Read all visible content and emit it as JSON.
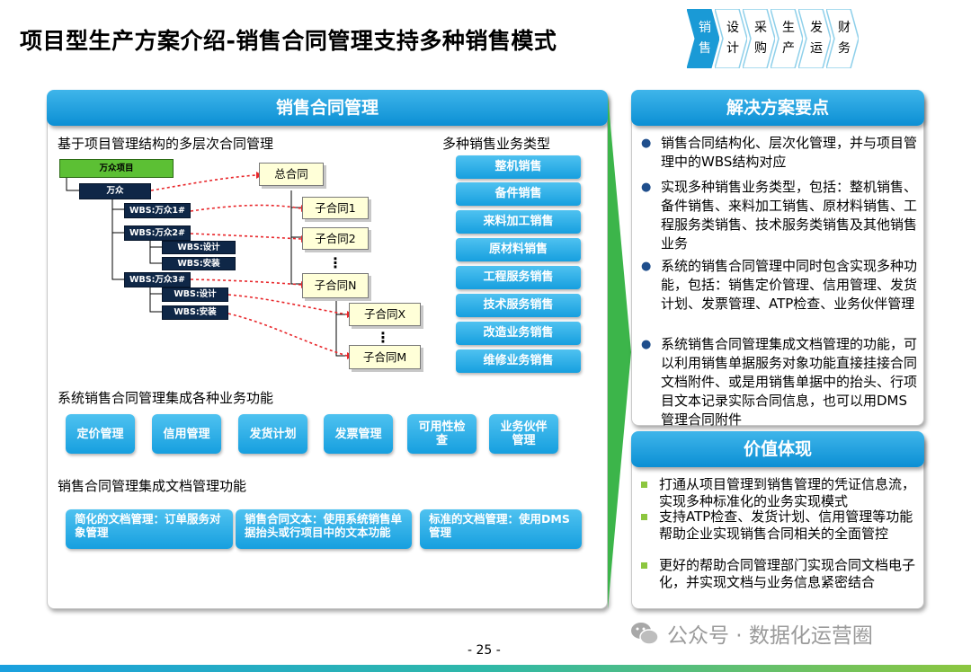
{
  "title": "项目型生产方案介绍-销售合同管理支持多种销售模式",
  "process_steps": [
    {
      "t1": "销",
      "t2": "售"
    },
    {
      "t1": "设",
      "t2": "计"
    },
    {
      "t1": "采",
      "t2": "购"
    },
    {
      "t1": "生",
      "t2": "产"
    },
    {
      "t1": "发",
      "t2": "运"
    },
    {
      "t1": "财",
      "t2": "务"
    }
  ],
  "left_panel": {
    "header": "销售合同管理",
    "structure_title": "基于项目管理结构的多层次合同管理",
    "types_title": "多种销售业务类型",
    "wbs": {
      "root": "万众项目",
      "wanzhong": "万众",
      "w1": "WBS:万众1#",
      "w2": "WBS:万众2#",
      "w2a": "WBS:设计",
      "w2b": "WBS:安装",
      "w3": "WBS:万众3#",
      "w3a": "WBS:设计",
      "w3b": "WBS:安装"
    },
    "contracts": {
      "main": "总合同",
      "sub1": "子合同1",
      "sub2": "子合同2",
      "subN": "子合同N",
      "subX": "子合同X",
      "subM": "子合同M",
      "dots": "⋮"
    },
    "sales_types": [
      "整机销售",
      "备件销售",
      "来料加工销售",
      "原材料销售",
      "工程服务销售",
      "技术服务销售",
      "改造业务销售",
      "维修业务销售"
    ],
    "functions_title": "系统销售合同管理集成各种业务功能",
    "functions": [
      "定价管理",
      "信用管理",
      "发货计划",
      "发票管理",
      "可用性检查",
      "业务伙伴管理"
    ],
    "docs_title": "销售合同管理集成文档管理功能",
    "docs": [
      "简化的文档管理：订单服务对象管理",
      "销售合同文本：使用系统销售单据抬头或行项目中的文本功能",
      "标准的文档管理：使用DMS管理"
    ]
  },
  "right_top": {
    "header": "解决方案要点",
    "bullets": [
      "销售合同结构化、层次化管理，并与项目管理中的WBS结构对应",
      "实现多种销售业务类型，包括：整机销售、备件销售、来料加工销售、原材料销售、工程服务类销售、技术服务类销售及其他销售业务",
      "系统的销售合同管理中同时包含实现多种功能，包括：销售定价管理、信用管理、发货计划、发票管理、ATP检查、业务伙伴管理",
      "系统销售合同管理集成文档管理的功能，可以利用销售单据服务对象功能直接挂接合同文档附件、或是用销售单据中的抬头、行项目文本记录实际合同信息，也可以用DMS管理合同附件"
    ]
  },
  "right_bottom": {
    "header": "价值体现",
    "bullets": [
      "打通从项目管理到销售管理的凭证信息流，实现多种标准化的业务实现模式",
      "支持ATP检查、发货计划、信用管理等功能帮助企业实现销售合同相关的全面管控",
      "更好的帮助合同管理部门实现合同文档电子化，并实现文档与业务信息紧密结合"
    ]
  },
  "watermark": "公众号 · 数据化运营圈",
  "page_number": "- 25 -",
  "colors": {
    "accent": "#169fdf",
    "navy": "#0f2747",
    "green": "#8cc63f",
    "contract_fill": "#ffffd8"
  }
}
